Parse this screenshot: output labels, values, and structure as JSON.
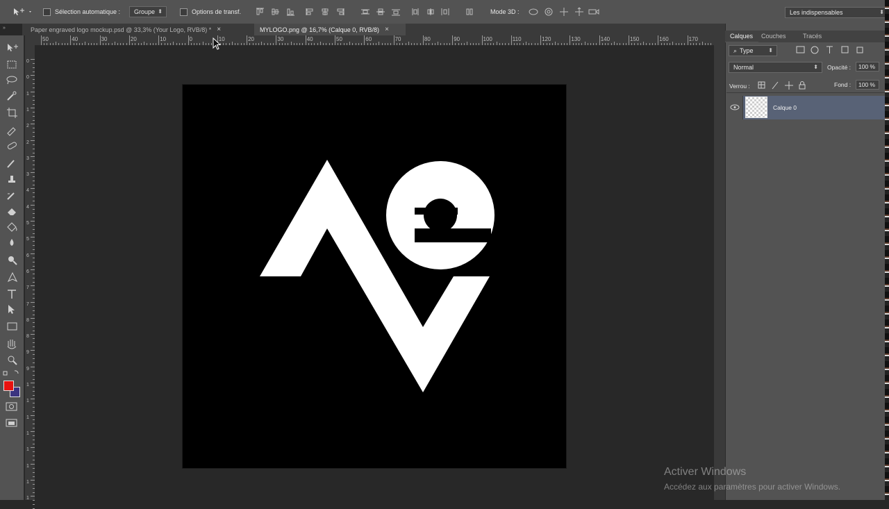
{
  "options_bar": {
    "auto_select_label": "Sélection automatique :",
    "auto_select_value": "Groupe",
    "transform_label": "Options de transf.",
    "mode3d_label": "Mode 3D :",
    "workspace_value": "Les indispensables"
  },
  "tabs": [
    {
      "label": "Paper engraved logo mockup.psd @ 33,3% (Your Logo, RVB/8) *",
      "active": false
    },
    {
      "label": "MYLOGO.png @ 16,7% (Calque 0, RVB/8)",
      "active": true
    }
  ],
  "ruler": {
    "h_labels": [
      "50",
      "40",
      "30",
      "20",
      "10",
      "0",
      "10",
      "20",
      "30",
      "40",
      "50",
      "60",
      "70",
      "80",
      "90",
      "100",
      "110",
      "120",
      "130",
      "140",
      "150",
      "160",
      "170"
    ],
    "v_labels": [
      "0",
      "0",
      "1",
      "1",
      "2",
      "2",
      "3",
      "3",
      "4",
      "4",
      "5",
      "5",
      "6",
      "6",
      "7",
      "7",
      "8",
      "8",
      "9",
      "9",
      "1",
      "1",
      "1",
      "1",
      "1",
      "1",
      "1",
      "1"
    ]
  },
  "layers_panel": {
    "tabs": [
      "Calques",
      "Couches",
      "Tracés"
    ],
    "filter_label": "Type",
    "blend_mode": "Normal",
    "opacity_label": "Opacité :",
    "opacity_value": "100 %",
    "lock_label": "Verrou :",
    "fill_label": "Fond :",
    "fill_value": "100 %",
    "layers": [
      {
        "name": "Calque 0",
        "selected": true
      }
    ]
  },
  "colors": {
    "foreground": "#e8120f",
    "background": "#3b3480",
    "layer_highlight": "#586276"
  },
  "watermark": {
    "title": "Activer Windows",
    "subtitle": "Accédez aux paramètres pour activer Windows."
  }
}
